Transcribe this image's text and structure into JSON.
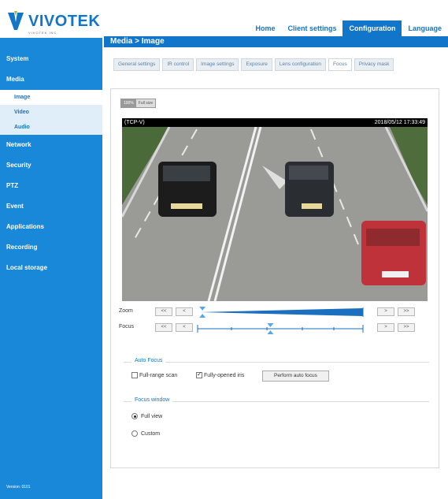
{
  "brand": {
    "name": "VIVOTEK",
    "tagline": "VIVOTEK INC."
  },
  "topnav": {
    "home": "Home",
    "client_settings": "Client settings",
    "configuration": "Configuration",
    "language": "Language"
  },
  "breadcrumb": "Media  >  Image",
  "sidebar": {
    "items": [
      "System",
      "Media",
      "Network",
      "Security",
      "PTZ",
      "Event",
      "Applications",
      "Recording",
      "Local storage"
    ],
    "media_sub": [
      "Image",
      "Video",
      "Audio"
    ],
    "version": "Version: 0101"
  },
  "subtabs": [
    "General settings",
    "IR control",
    "Image settings",
    "Exposure",
    "Lens configuration",
    "Focus",
    "Privacy mask"
  ],
  "view": {
    "ratio_a": "100%",
    "ratio_b": "Full size"
  },
  "video": {
    "channel": "(TCP-V)",
    "timestamp": "2018/05/12 17:33:49"
  },
  "controls": {
    "zoom_label": "Zoom",
    "focus_label": "Focus",
    "btn_fast_back": "<<",
    "btn_back": "<",
    "btn_fwd": ">",
    "btn_fast_fwd": ">>",
    "zoom_position": 0.02,
    "focus_position": 0.44
  },
  "autofocus": {
    "legend": "Auto Focus",
    "full_range": "Full-range scan",
    "full_range_checked": false,
    "fully_opened": "Fully-opened iris",
    "fully_opened_checked": true,
    "perform_btn": "Perform auto focus"
  },
  "focus_window": {
    "legend": "Focus window",
    "full_view": "Full view",
    "custom": "Custom",
    "selected": "full_view"
  },
  "colors": {
    "accent": "#1175c9",
    "sidebar": "#1a88d8",
    "sub_bg": "#e0eef9"
  }
}
